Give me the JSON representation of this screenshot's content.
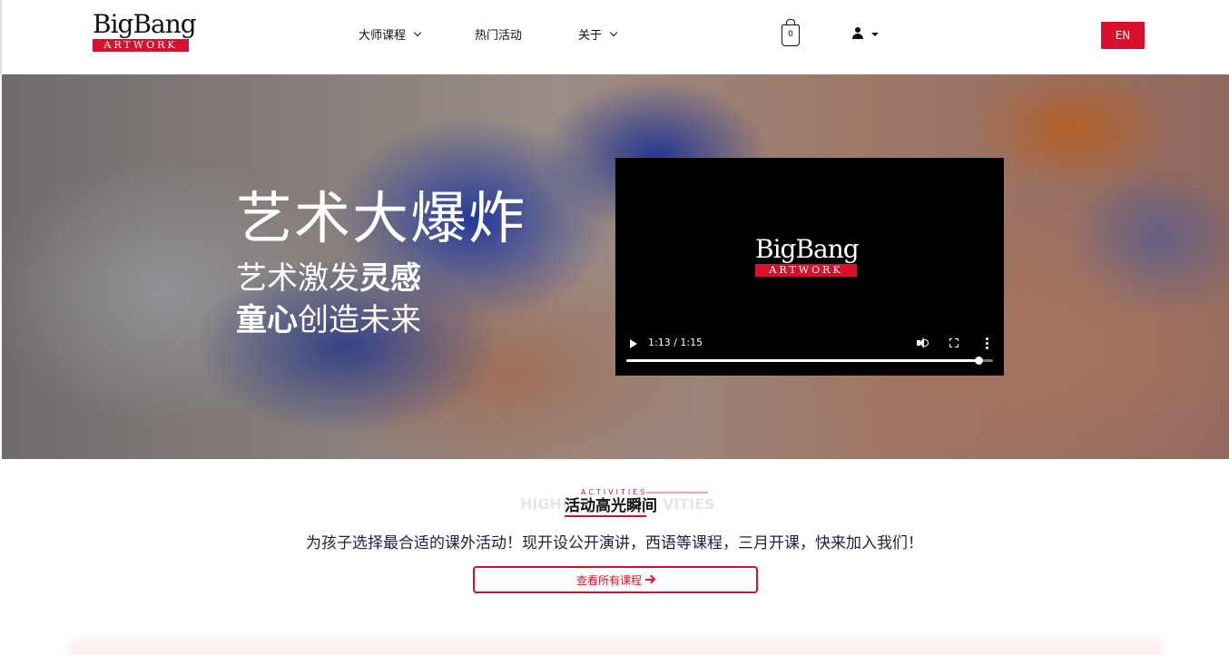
{
  "header": {
    "logo": {
      "main": "BigBang",
      "band": "ARTWORK"
    },
    "nav": [
      {
        "label": "大师课程",
        "has_dropdown": true
      },
      {
        "label": "热门活动",
        "has_dropdown": false
      },
      {
        "label": "关于",
        "has_dropdown": true
      }
    ],
    "cart_count": "0",
    "lang_button": "EN",
    "accent_color": "#d8102b"
  },
  "hero": {
    "title": "艺术大爆炸",
    "line1_normal": "艺术激发",
    "line1_bold": "灵感",
    "line2_bold": "童心",
    "line2_normal": "创造未来",
    "video": {
      "logo_main": "BigBang",
      "logo_band": "ARTWORK",
      "time": "1:13 / 1:15",
      "progress": 0.96
    }
  },
  "activities": {
    "bg_en_left": "HIGHL",
    "bg_en_right": "VITIES",
    "mini_en": "ACTIVITIES",
    "title": "活动高光瞬间",
    "description": "为孩子选择最合适的课外活动！现开设公开演讲，西语等课程，三月开课，快来加入我们！",
    "button_label": "查看所有课程"
  }
}
